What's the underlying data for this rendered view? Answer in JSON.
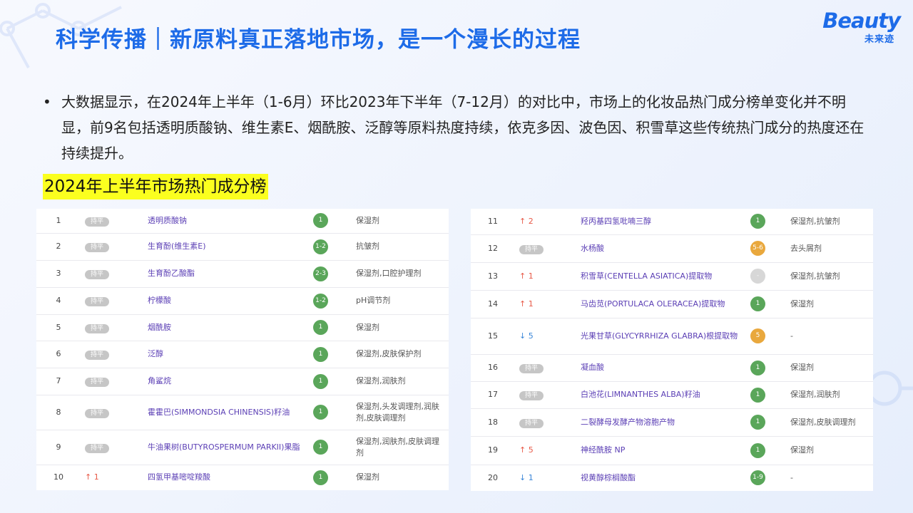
{
  "header": {
    "title": "科学传播｜新原料真正落地市场，是一个漫长的过程",
    "logo_main": "Beauty",
    "logo_sub": "未来迹"
  },
  "bullet": {
    "text": "大数据显示，在2024年上半年（1-6月）环比2023年下半年（7-12月）的对比中，市场上的化妆品热门成分榜单变化并不明显，前9名包括透明质酸钠、维生素E、烟酰胺、泛醇等原料热度持续，依克多因、波色因、积雪草这些传统热门成分的热度还在持续提升。"
  },
  "section_label": "2024年上半年市场热门成分榜",
  "colors": {
    "title_blue": "#1d6be8",
    "name_purple": "#5b3fb5",
    "up_red": "#e85a48",
    "down_blue": "#3a86d8",
    "badge_green": "#5aa65a",
    "badge_orange": "#e9a83d",
    "badge_grey": "#d7d7d7",
    "highlight_yellow": "#fbff1f"
  },
  "left_table": [
    {
      "rank": "1",
      "change_type": "flat",
      "change": "持平",
      "name": "透明质酸钠",
      "score": "1",
      "score_color": "green",
      "use": "保湿剂"
    },
    {
      "rank": "2",
      "change_type": "flat",
      "change": "持平",
      "name": "生育酚(维生素E)",
      "score": "1-2",
      "score_color": "green",
      "use": "抗皱剂"
    },
    {
      "rank": "3",
      "change_type": "flat",
      "change": "持平",
      "name": "生育酚乙酸酯",
      "score": "2-3",
      "score_color": "green",
      "use": "保湿剂,口腔护理剂"
    },
    {
      "rank": "4",
      "change_type": "flat",
      "change": "持平",
      "name": "柠檬酸",
      "score": "1-2",
      "score_color": "green",
      "use": "pH调节剂"
    },
    {
      "rank": "5",
      "change_type": "flat",
      "change": "持平",
      "name": "烟酰胺",
      "score": "1",
      "score_color": "green",
      "use": "保湿剂"
    },
    {
      "rank": "6",
      "change_type": "flat",
      "change": "持平",
      "name": "泛醇",
      "score": "1",
      "score_color": "green",
      "use": "保湿剂,皮肤保护剂"
    },
    {
      "rank": "7",
      "change_type": "flat",
      "change": "持平",
      "name": "角鲨烷",
      "score": "1",
      "score_color": "green",
      "use": "保湿剂,润肤剂"
    },
    {
      "rank": "8",
      "change_type": "flat",
      "change": "持平",
      "name": "霍霍巴(SIMMONDSIA CHINENSIS)籽油",
      "score": "1",
      "score_color": "green",
      "use": "保湿剂,头发调理剂,润肤剂,皮肤调理剂"
    },
    {
      "rank": "9",
      "change_type": "flat",
      "change": "持平",
      "name": "牛油果树(BUTYROSPERMUM PARKII)果脂",
      "score": "1",
      "score_color": "green",
      "use": "保湿剂,润肤剂,皮肤调理剂"
    },
    {
      "rank": "10",
      "change_type": "up",
      "change": "↑ 1",
      "name": "四氢甲基嘧啶羧酸",
      "score": "1",
      "score_color": "green",
      "use": "保湿剂"
    }
  ],
  "right_table": [
    {
      "rank": "11",
      "change_type": "up",
      "change": "↑ 2",
      "name": "羟丙基四氢吡喃三醇",
      "score": "1",
      "score_color": "green",
      "use": "保湿剂,抗皱剂"
    },
    {
      "rank": "12",
      "change_type": "flat",
      "change": "持平",
      "name": "水杨酸",
      "score": "5-6",
      "score_color": "orange",
      "use": "去头屑剂"
    },
    {
      "rank": "13",
      "change_type": "up",
      "change": "↑ 1",
      "name": "积雪草(CENTELLA ASIATICA)提取物",
      "score": "-",
      "score_color": "grey",
      "use": "保湿剂,抗皱剂"
    },
    {
      "rank": "14",
      "change_type": "up",
      "change": "↑ 1",
      "name": "马齿苋(PORTULACA OLERACEA)提取物",
      "score": "1",
      "score_color": "green",
      "use": "保湿剂"
    },
    {
      "rank": "15",
      "change_type": "down",
      "change": "↓ 5",
      "name": "光果甘草(GLYCYRRHIZA GLABRA)根提取物",
      "score": "5",
      "score_color": "orange",
      "use": "-"
    },
    {
      "rank": "16",
      "change_type": "flat",
      "change": "持平",
      "name": "凝血酸",
      "score": "1",
      "score_color": "green",
      "use": "保湿剂"
    },
    {
      "rank": "17",
      "change_type": "flat",
      "change": "持平",
      "name": "白池花(LIMNANTHES ALBA)籽油",
      "score": "1",
      "score_color": "green",
      "use": "保湿剂,润肤剂"
    },
    {
      "rank": "18",
      "change_type": "flat",
      "change": "持平",
      "name": "二裂酵母发酵产物溶胞产物",
      "score": "1",
      "score_color": "green",
      "use": "保湿剂,皮肤调理剂"
    },
    {
      "rank": "19",
      "change_type": "up",
      "change": "↑ 5",
      "name": "神经酰胺 NP",
      "score": "1",
      "score_color": "green",
      "use": "保湿剂"
    },
    {
      "rank": "20",
      "change_type": "down",
      "change": "↓ 1",
      "name": "视黄醇棕榈酸酯",
      "score": "1-9",
      "score_color": "green",
      "use": "-"
    }
  ]
}
